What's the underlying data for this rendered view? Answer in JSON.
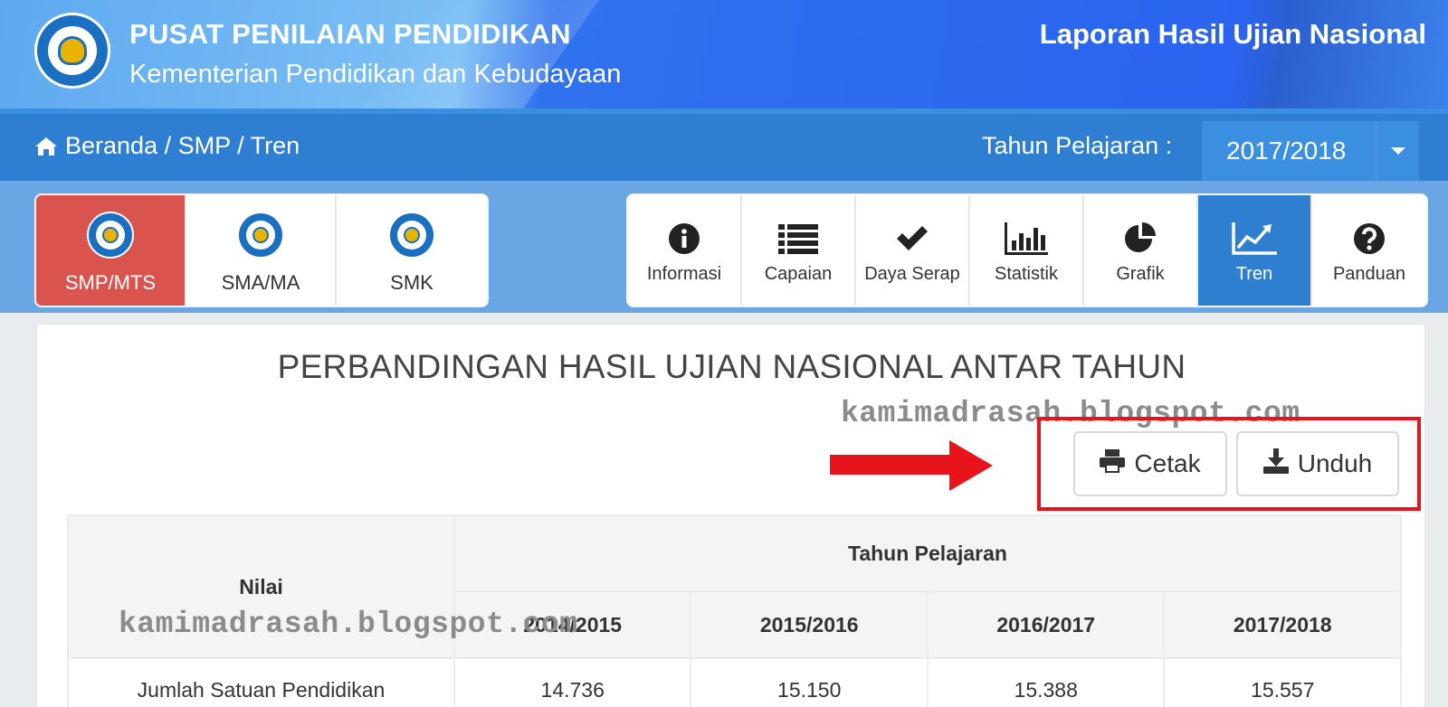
{
  "header": {
    "org_title": "PUSAT PENILAIAN PENDIDIKAN",
    "org_subtitle": "Kementerian Pendidikan dan Kebudayaan",
    "report_title": "Laporan Hasil Ujian Nasional"
  },
  "breadcrumb": {
    "text": "Beranda / SMP / Tren"
  },
  "year_selector": {
    "label": "Tahun Pelajaran :",
    "selected": "2017/2018"
  },
  "levels": [
    {
      "label": "SMP/MTS",
      "active": true
    },
    {
      "label": "SMA/MA",
      "active": false
    },
    {
      "label": "SMK",
      "active": false
    }
  ],
  "menu": [
    {
      "label": "Informasi",
      "icon": "info-circle-icon"
    },
    {
      "label": "Capaian",
      "icon": "list-icon"
    },
    {
      "label": "Daya Serap",
      "icon": "check-icon"
    },
    {
      "label": "Statistik",
      "icon": "bar-chart-icon"
    },
    {
      "label": "Grafik",
      "icon": "pie-chart-icon"
    },
    {
      "label": "Tren",
      "icon": "line-chart-icon",
      "active": true
    },
    {
      "label": "Panduan",
      "icon": "question-circle-icon"
    }
  ],
  "content": {
    "title": "PERBANDINGAN HASIL UJIAN NASIONAL ANTAR TAHUN",
    "watermark": "kamimadrasah.blogspot.com",
    "print_label": "Cetak",
    "download_label": "Unduh"
  },
  "table": {
    "header_nilai": "Nilai",
    "header_group": "Tahun Pelajaran",
    "years": [
      "2014/2015",
      "2015/2016",
      "2016/2017",
      "2017/2018"
    ],
    "rows": [
      {
        "label": "Jumlah Satuan Pendidikan",
        "values": [
          "14.736",
          "15.150",
          "15.388",
          "15.557"
        ]
      }
    ]
  },
  "colors": {
    "accent_blue": "#2e7fd1",
    "active_level": "#d9534f",
    "highlight_red": "#e8141c"
  }
}
